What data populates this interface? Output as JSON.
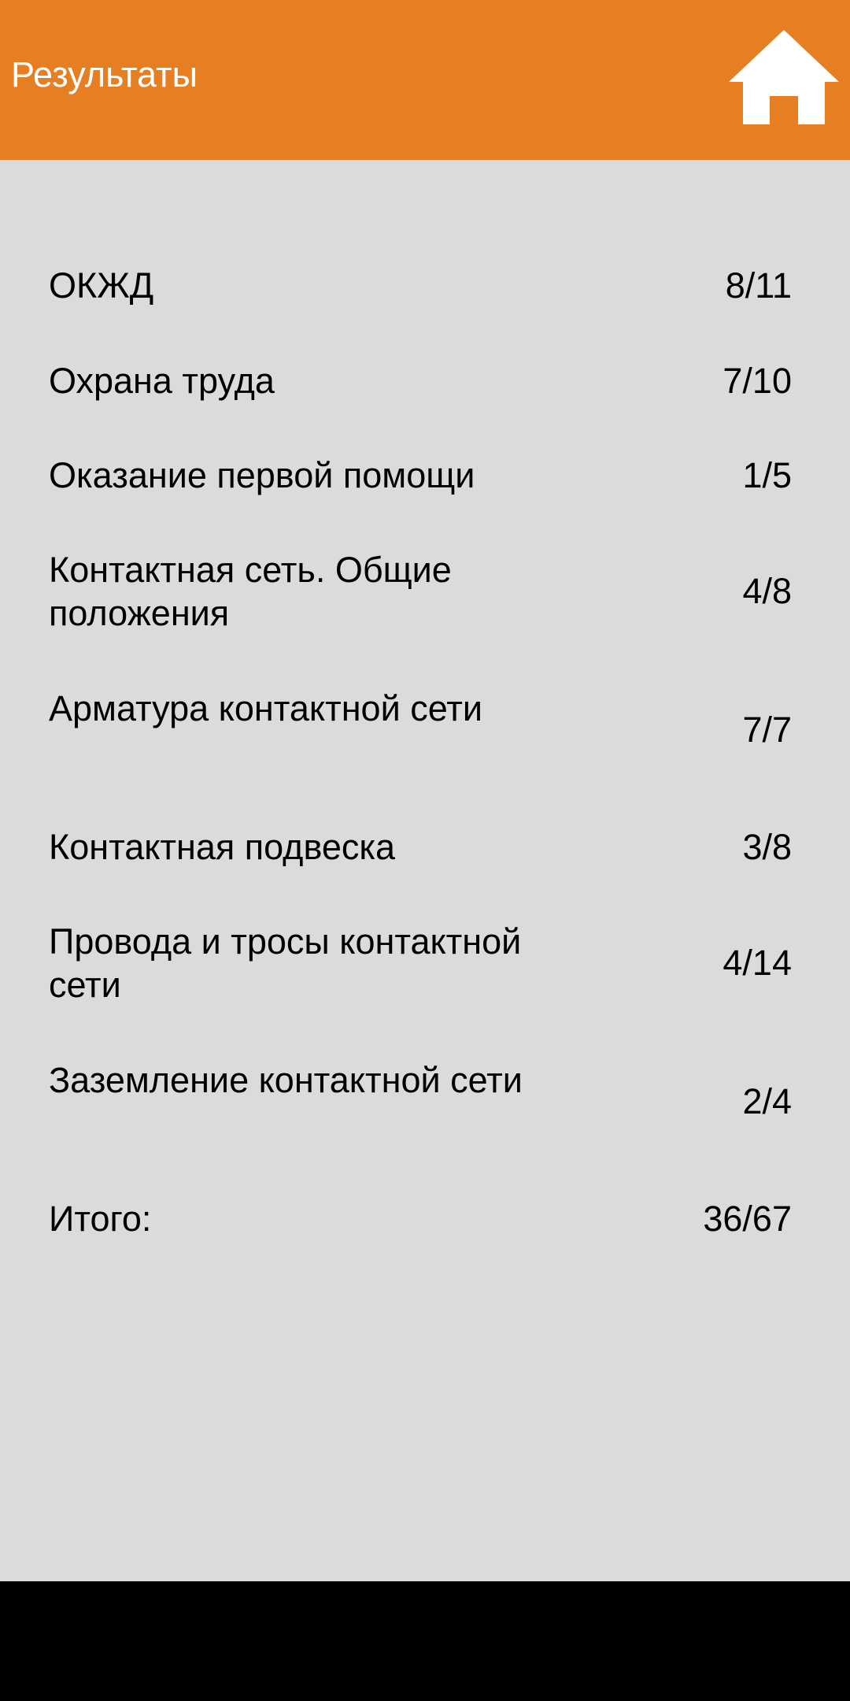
{
  "header": {
    "title": "Результаты",
    "home_icon": "home-icon",
    "bar_color": "#e67e22"
  },
  "results": [
    {
      "label": "ОКЖД",
      "score": "8/11"
    },
    {
      "label": "Охрана труда",
      "score": "7/10"
    },
    {
      "label": "Оказание первой помощи",
      "score": "1/5"
    },
    {
      "label": "Контактная сеть. Общие положения",
      "score": "4/8"
    },
    {
      "label": "Арматура контактной сети",
      "score": "7/7"
    },
    {
      "label": "Контактная подвеска",
      "score": "3/8"
    },
    {
      "label": "Провода и тросы контактной сети",
      "score": "4/14"
    },
    {
      "label": "Заземление контактной сети",
      "score": "2/4"
    }
  ],
  "total": {
    "label": "Итого:",
    "score": "36/67"
  }
}
